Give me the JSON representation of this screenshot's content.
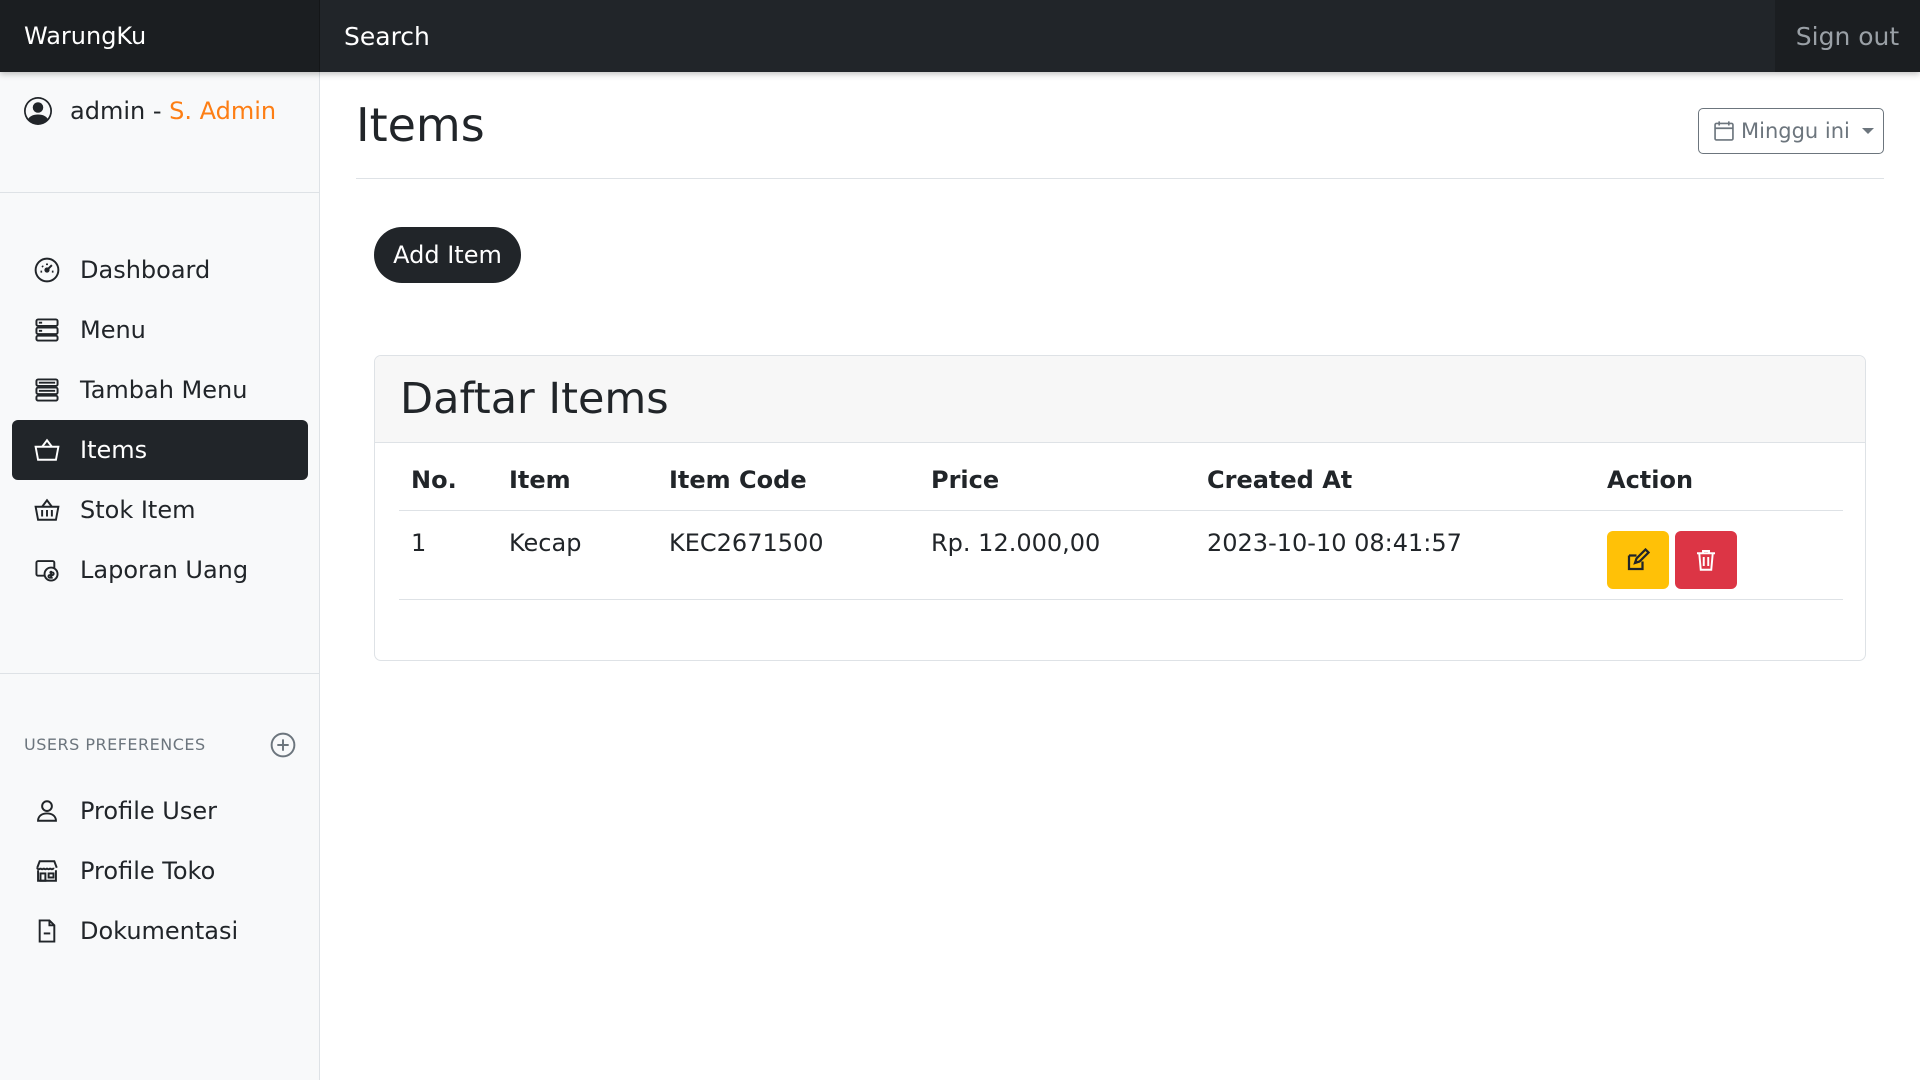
{
  "navbar": {
    "brand": "WarungKu",
    "search_placeholder": "Search",
    "signout": "Sign out"
  },
  "user": {
    "name": "admin",
    "separator": " - ",
    "role": "S. Admin"
  },
  "sidebar": {
    "items": [
      {
        "label": "Dashboard",
        "icon": "speedometer-icon"
      },
      {
        "label": "Menu",
        "icon": "menu-list-icon"
      },
      {
        "label": "Tambah Menu",
        "icon": "add-menu-icon"
      },
      {
        "label": "Items",
        "icon": "basket-icon",
        "active": true
      },
      {
        "label": "Stok Item",
        "icon": "stock-basket-icon"
      },
      {
        "label": "Laporan Uang",
        "icon": "money-report-icon"
      }
    ],
    "section_title": "USERS PREFERENCES",
    "pref_items": [
      {
        "label": "Profile User",
        "icon": "person-icon"
      },
      {
        "label": "Profile Toko",
        "icon": "shop-icon"
      },
      {
        "label": "Dokumentasi",
        "icon": "document-icon"
      }
    ]
  },
  "main": {
    "title": "Items",
    "range_label": "Minggu ini",
    "add_button": "Add Item",
    "card_title": "Daftar Items",
    "columns": [
      "No.",
      "Item",
      "Item Code",
      "Price",
      "Created At",
      "Action"
    ],
    "rows": [
      {
        "no": "1",
        "item": "Kecap",
        "code": "KEC2671500",
        "price": "Rp. 12.000,00",
        "created_at": "2023-10-10 08:41:57"
      }
    ]
  },
  "colors": {
    "navbar": "#212529",
    "active_nav": "#212529",
    "role_accent": "#fd7e14",
    "edit_button": "#ffc107",
    "delete_button": "#dc3545"
  }
}
